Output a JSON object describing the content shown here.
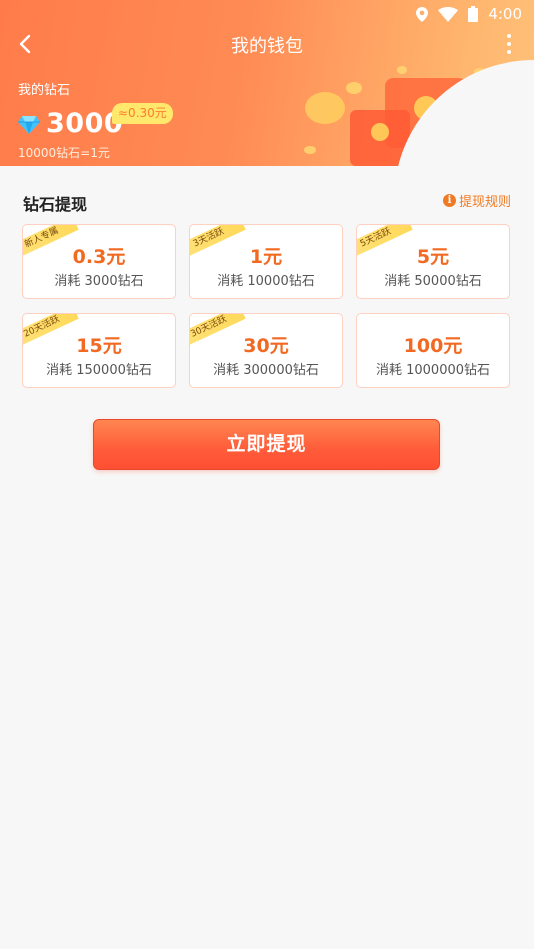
{
  "status_bar": {
    "time": "4:00",
    "icons": [
      "location-icon",
      "wifi-icon",
      "battery-icon"
    ]
  },
  "nav": {
    "title": "我的钱包",
    "back_icon": "chevron-left-icon",
    "more_icon": "more-vertical-icon"
  },
  "balance": {
    "label": "我的钻石",
    "value": "3000",
    "approx": "≈0.30元",
    "rate": "10000钻石=1元"
  },
  "withdraw": {
    "section_title": "钻石提现",
    "rules_label": "提现规则",
    "options": [
      {
        "tag": "新人专属",
        "amount": "0.3元",
        "cost": "消耗 3000钻石"
      },
      {
        "tag": "3天活跃",
        "amount": "1元",
        "cost": "消耗 10000钻石"
      },
      {
        "tag": "5天活跃",
        "amount": "5元",
        "cost": "消耗 50000钻石"
      },
      {
        "tag": "20天活跃",
        "amount": "15元",
        "cost": "消耗 150000钻石"
      },
      {
        "tag": "30天活跃",
        "amount": "30元",
        "cost": "消耗 300000钻石"
      },
      {
        "tag": "",
        "amount": "100元",
        "cost": "消耗 1000000钻石"
      }
    ],
    "button_label": "立即提现"
  },
  "colors": {
    "header_start": "#ff7c4a",
    "header_end": "#ffc27a",
    "accent": "#f26a22",
    "badge": "#ffe86b"
  }
}
